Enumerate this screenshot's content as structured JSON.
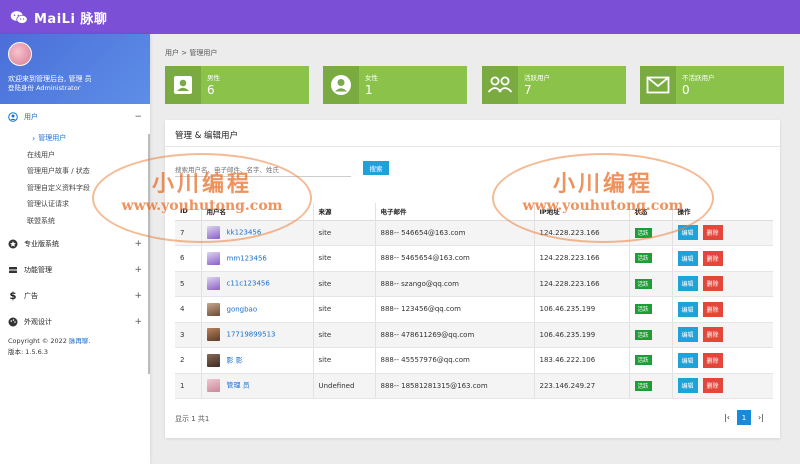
{
  "app": {
    "brand": "MaiLi 脉聊"
  },
  "sidebar": {
    "welcome": "欢迎来到管理后台, 管理 员",
    "role": "登陆身份 Administrator",
    "menu": {
      "users": {
        "label": "用户",
        "toggle": "−"
      },
      "sub": [
        {
          "label": "管理用户"
        },
        {
          "label": "在线用户"
        },
        {
          "label": "管理用户故事 / 状态"
        },
        {
          "label": "管理自定义资料字段"
        },
        {
          "label": "管理认证请求"
        },
        {
          "label": "联盟系统"
        }
      ],
      "pro": {
        "label": "专业版系统",
        "toggle": "+"
      },
      "features": {
        "label": "功能管理",
        "toggle": "+"
      },
      "ads": {
        "label": "广告",
        "toggle": "+"
      },
      "design": {
        "label": "外观设计",
        "toggle": "+"
      }
    },
    "copyright_prefix": "Copyright © 2022 ",
    "copyright_link": "脉再聊",
    "copyright_suffix": ".",
    "version": "版本: 1.5.6.3"
  },
  "breadcrumb": "用户 > 管理用户",
  "stats": [
    {
      "label": "男性",
      "value": "6",
      "icon": "male-user-icon"
    },
    {
      "label": "女性",
      "value": "1",
      "icon": "female-user-icon"
    },
    {
      "label": "活跃用户",
      "value": "7",
      "icon": "active-users-icon"
    },
    {
      "label": "不活跃用户",
      "value": "0",
      "icon": "mail-icon"
    }
  ],
  "card": {
    "title": "管理 & 编辑用户",
    "search_placeholder": "搜索用户名、电子邮件、名字、姓氏",
    "search_button": "搜索"
  },
  "table": {
    "headers": [
      "ID",
      "用户名",
      "来源",
      "电子邮件",
      "IP地址",
      "状态",
      "操作"
    ],
    "rows": [
      {
        "id": "7",
        "username": "kk123456",
        "source": "site",
        "email": "888-- 546654@163.com",
        "ip": "124.228.223.166",
        "status": "活跃",
        "edit": "编辑",
        "delete": "删除"
      },
      {
        "id": "6",
        "username": "mm123456",
        "source": "site",
        "email": "888-- 5465654@163.com",
        "ip": "124.228.223.166",
        "status": "活跃",
        "edit": "编辑",
        "delete": "删除"
      },
      {
        "id": "5",
        "username": "c11c123456",
        "source": "site",
        "email": "888-- szango@qq.com",
        "ip": "124.228.223.166",
        "status": "活跃",
        "edit": "编辑",
        "delete": "删除"
      },
      {
        "id": "4",
        "username": "gongbao",
        "source": "site",
        "email": "888-- 123456@qq.com",
        "ip": "106.46.235.199",
        "status": "活跃",
        "edit": "编辑",
        "delete": "删除"
      },
      {
        "id": "3",
        "username": "17719899513",
        "source": "site",
        "email": "888-- 478611269@qq.com",
        "ip": "106.46.235.199",
        "status": "活跃",
        "edit": "编辑",
        "delete": "删除"
      },
      {
        "id": "2",
        "username": "影 影",
        "source": "site",
        "email": "888-- 45557976@qq.com",
        "ip": "183.46.222.106",
        "status": "活跃",
        "edit": "编辑",
        "delete": "删除"
      },
      {
        "id": "1",
        "username": "管理 员",
        "source": "Undefined",
        "email": "888-- 18581281315@163.com",
        "ip": "223.146.249.27",
        "status": "活跃",
        "edit": "编辑",
        "delete": "删除"
      }
    ]
  },
  "pagination": {
    "info": "显示 1 共1",
    "current": "1",
    "first": "|‹",
    "last": "›|"
  },
  "watermark": {
    "line1": "小川编程",
    "line2": "www.youhutong.com"
  },
  "colors": {
    "topbar": "#7b4fd6",
    "stat_green": "#8bc34a",
    "primary_blue": "#1fa2d8",
    "danger_red": "#e4473a",
    "active_green": "#1e9c36"
  }
}
